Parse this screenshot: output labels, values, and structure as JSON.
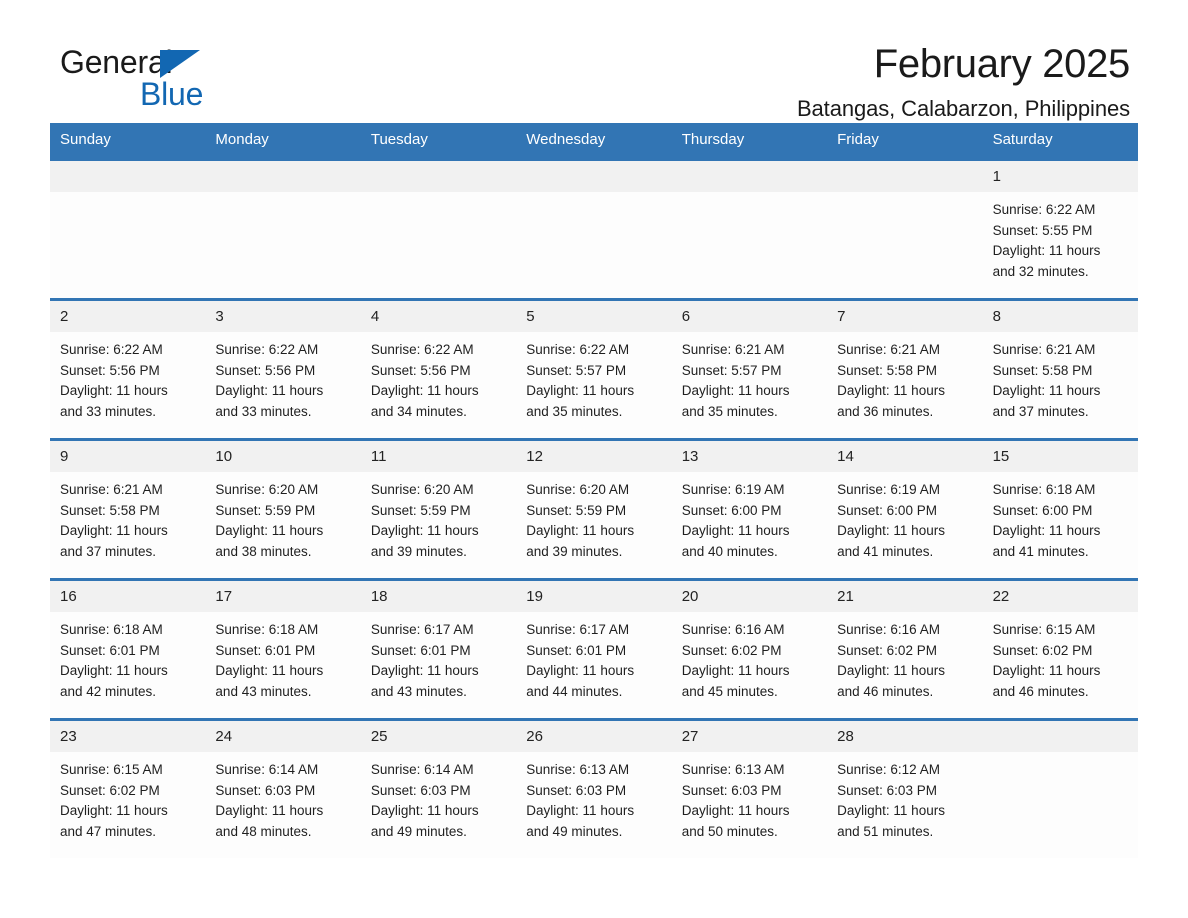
{
  "brand": {
    "name_part1": "General",
    "name_part2": "Blue",
    "accent_color": "#1267b2"
  },
  "header": {
    "title": "February 2025",
    "subtitle": "Batangas, Calabarzon, Philippines"
  },
  "theme": {
    "header_blue": "#3275b4",
    "daynum_band": "#f1f1f1",
    "text": "#1f1f1f"
  },
  "weekdays": [
    "Sunday",
    "Monday",
    "Tuesday",
    "Wednesday",
    "Thursday",
    "Friday",
    "Saturday"
  ],
  "weeks": [
    [
      {
        "day": "",
        "sunrise": "",
        "sunset": "",
        "daylight": "",
        "daylight2": ""
      },
      {
        "day": "",
        "sunrise": "",
        "sunset": "",
        "daylight": "",
        "daylight2": ""
      },
      {
        "day": "",
        "sunrise": "",
        "sunset": "",
        "daylight": "",
        "daylight2": ""
      },
      {
        "day": "",
        "sunrise": "",
        "sunset": "",
        "daylight": "",
        "daylight2": ""
      },
      {
        "day": "",
        "sunrise": "",
        "sunset": "",
        "daylight": "",
        "daylight2": ""
      },
      {
        "day": "",
        "sunrise": "",
        "sunset": "",
        "daylight": "",
        "daylight2": ""
      },
      {
        "day": "1",
        "sunrise": "Sunrise: 6:22 AM",
        "sunset": "Sunset: 5:55 PM",
        "daylight": "Daylight: 11 hours",
        "daylight2": "and 32 minutes."
      }
    ],
    [
      {
        "day": "2",
        "sunrise": "Sunrise: 6:22 AM",
        "sunset": "Sunset: 5:56 PM",
        "daylight": "Daylight: 11 hours",
        "daylight2": "and 33 minutes."
      },
      {
        "day": "3",
        "sunrise": "Sunrise: 6:22 AM",
        "sunset": "Sunset: 5:56 PM",
        "daylight": "Daylight: 11 hours",
        "daylight2": "and 33 minutes."
      },
      {
        "day": "4",
        "sunrise": "Sunrise: 6:22 AM",
        "sunset": "Sunset: 5:56 PM",
        "daylight": "Daylight: 11 hours",
        "daylight2": "and 34 minutes."
      },
      {
        "day": "5",
        "sunrise": "Sunrise: 6:22 AM",
        "sunset": "Sunset: 5:57 PM",
        "daylight": "Daylight: 11 hours",
        "daylight2": "and 35 minutes."
      },
      {
        "day": "6",
        "sunrise": "Sunrise: 6:21 AM",
        "sunset": "Sunset: 5:57 PM",
        "daylight": "Daylight: 11 hours",
        "daylight2": "and 35 minutes."
      },
      {
        "day": "7",
        "sunrise": "Sunrise: 6:21 AM",
        "sunset": "Sunset: 5:58 PM",
        "daylight": "Daylight: 11 hours",
        "daylight2": "and 36 minutes."
      },
      {
        "day": "8",
        "sunrise": "Sunrise: 6:21 AM",
        "sunset": "Sunset: 5:58 PM",
        "daylight": "Daylight: 11 hours",
        "daylight2": "and 37 minutes."
      }
    ],
    [
      {
        "day": "9",
        "sunrise": "Sunrise: 6:21 AM",
        "sunset": "Sunset: 5:58 PM",
        "daylight": "Daylight: 11 hours",
        "daylight2": "and 37 minutes."
      },
      {
        "day": "10",
        "sunrise": "Sunrise: 6:20 AM",
        "sunset": "Sunset: 5:59 PM",
        "daylight": "Daylight: 11 hours",
        "daylight2": "and 38 minutes."
      },
      {
        "day": "11",
        "sunrise": "Sunrise: 6:20 AM",
        "sunset": "Sunset: 5:59 PM",
        "daylight": "Daylight: 11 hours",
        "daylight2": "and 39 minutes."
      },
      {
        "day": "12",
        "sunrise": "Sunrise: 6:20 AM",
        "sunset": "Sunset: 5:59 PM",
        "daylight": "Daylight: 11 hours",
        "daylight2": "and 39 minutes."
      },
      {
        "day": "13",
        "sunrise": "Sunrise: 6:19 AM",
        "sunset": "Sunset: 6:00 PM",
        "daylight": "Daylight: 11 hours",
        "daylight2": "and 40 minutes."
      },
      {
        "day": "14",
        "sunrise": "Sunrise: 6:19 AM",
        "sunset": "Sunset: 6:00 PM",
        "daylight": "Daylight: 11 hours",
        "daylight2": "and 41 minutes."
      },
      {
        "day": "15",
        "sunrise": "Sunrise: 6:18 AM",
        "sunset": "Sunset: 6:00 PM",
        "daylight": "Daylight: 11 hours",
        "daylight2": "and 41 minutes."
      }
    ],
    [
      {
        "day": "16",
        "sunrise": "Sunrise: 6:18 AM",
        "sunset": "Sunset: 6:01 PM",
        "daylight": "Daylight: 11 hours",
        "daylight2": "and 42 minutes."
      },
      {
        "day": "17",
        "sunrise": "Sunrise: 6:18 AM",
        "sunset": "Sunset: 6:01 PM",
        "daylight": "Daylight: 11 hours",
        "daylight2": "and 43 minutes."
      },
      {
        "day": "18",
        "sunrise": "Sunrise: 6:17 AM",
        "sunset": "Sunset: 6:01 PM",
        "daylight": "Daylight: 11 hours",
        "daylight2": "and 43 minutes."
      },
      {
        "day": "19",
        "sunrise": "Sunrise: 6:17 AM",
        "sunset": "Sunset: 6:01 PM",
        "daylight": "Daylight: 11 hours",
        "daylight2": "and 44 minutes."
      },
      {
        "day": "20",
        "sunrise": "Sunrise: 6:16 AM",
        "sunset": "Sunset: 6:02 PM",
        "daylight": "Daylight: 11 hours",
        "daylight2": "and 45 minutes."
      },
      {
        "day": "21",
        "sunrise": "Sunrise: 6:16 AM",
        "sunset": "Sunset: 6:02 PM",
        "daylight": "Daylight: 11 hours",
        "daylight2": "and 46 minutes."
      },
      {
        "day": "22",
        "sunrise": "Sunrise: 6:15 AM",
        "sunset": "Sunset: 6:02 PM",
        "daylight": "Daylight: 11 hours",
        "daylight2": "and 46 minutes."
      }
    ],
    [
      {
        "day": "23",
        "sunrise": "Sunrise: 6:15 AM",
        "sunset": "Sunset: 6:02 PM",
        "daylight": "Daylight: 11 hours",
        "daylight2": "and 47 minutes."
      },
      {
        "day": "24",
        "sunrise": "Sunrise: 6:14 AM",
        "sunset": "Sunset: 6:03 PM",
        "daylight": "Daylight: 11 hours",
        "daylight2": "and 48 minutes."
      },
      {
        "day": "25",
        "sunrise": "Sunrise: 6:14 AM",
        "sunset": "Sunset: 6:03 PM",
        "daylight": "Daylight: 11 hours",
        "daylight2": "and 49 minutes."
      },
      {
        "day": "26",
        "sunrise": "Sunrise: 6:13 AM",
        "sunset": "Sunset: 6:03 PM",
        "daylight": "Daylight: 11 hours",
        "daylight2": "and 49 minutes."
      },
      {
        "day": "27",
        "sunrise": "Sunrise: 6:13 AM",
        "sunset": "Sunset: 6:03 PM",
        "daylight": "Daylight: 11 hours",
        "daylight2": "and 50 minutes."
      },
      {
        "day": "28",
        "sunrise": "Sunrise: 6:12 AM",
        "sunset": "Sunset: 6:03 PM",
        "daylight": "Daylight: 11 hours",
        "daylight2": "and 51 minutes."
      },
      {
        "day": "",
        "sunrise": "",
        "sunset": "",
        "daylight": "",
        "daylight2": ""
      }
    ]
  ]
}
